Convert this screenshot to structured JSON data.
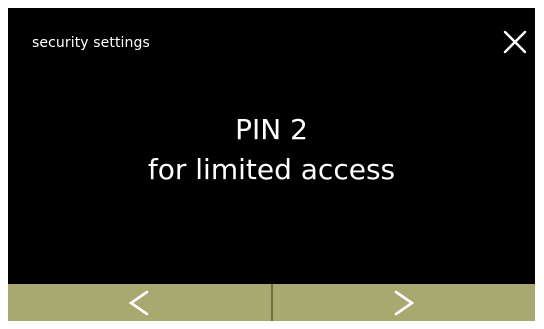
{
  "header": {
    "title": "security settings",
    "close_icon": "close-icon"
  },
  "message": {
    "line1": "PIN 2",
    "line2": "for limited access"
  },
  "footer": {
    "back_icon": "chevron-left-icon",
    "next_icon": "chevron-right-icon"
  },
  "colors": {
    "screen_background": "#000000",
    "text": "#ffffff",
    "footer_button": "#a8a871",
    "footer_divider": "#6d6d48"
  }
}
